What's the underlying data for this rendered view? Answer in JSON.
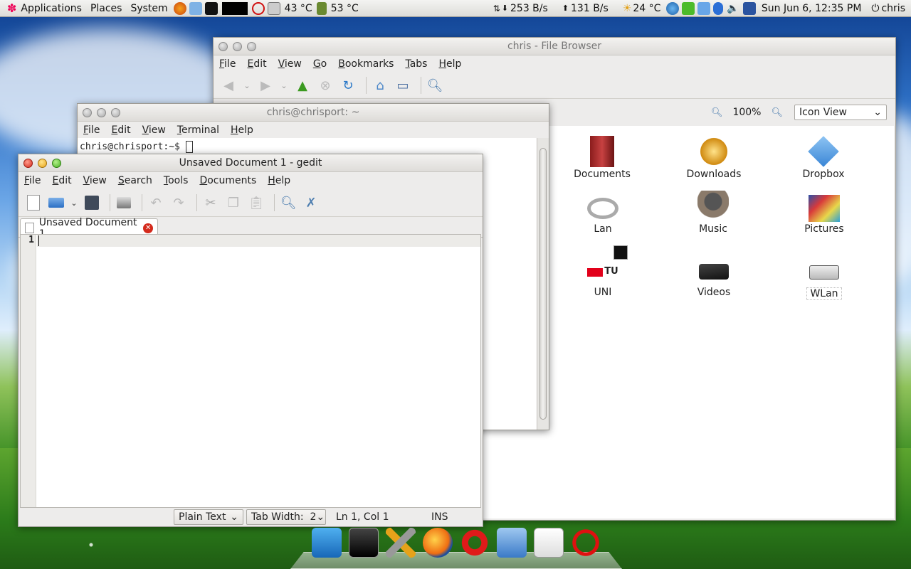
{
  "panel": {
    "menus": [
      "Applications",
      "Places",
      "System"
    ],
    "temp1": "43 °C",
    "temp2": "53 °C",
    "net_down": "253 B/s",
    "net_up": "131 B/s",
    "weather": "24 °C",
    "clock": "Sun Jun  6, 12:35 PM",
    "user": "chris"
  },
  "file_browser": {
    "title": "chris - File Browser",
    "menu": [
      "File",
      "Edit",
      "View",
      "Go",
      "Bookmarks",
      "Tabs",
      "Help"
    ],
    "zoom": "100%",
    "view_mode": "Icon View",
    "items": [
      "Documents",
      "Downloads",
      "Dropbox",
      "Lan",
      "Music",
      "Pictures",
      "UNI",
      "Videos",
      "WLan"
    ],
    "uni_badge": "TU"
  },
  "terminal": {
    "title": "chris@chrisport: ~",
    "menu": [
      "File",
      "Edit",
      "View",
      "Terminal",
      "Help"
    ],
    "prompt": "chris@chrisport:~$ "
  },
  "gedit": {
    "title": "Unsaved Document 1 - gedit",
    "menu": [
      "File",
      "Edit",
      "View",
      "Search",
      "Tools",
      "Documents",
      "Help"
    ],
    "tab_label": "Unsaved Document 1",
    "line_number": "1",
    "status": {
      "language": "Plain Text",
      "tab_width": "Tab Width:  2",
      "position": "Ln 1, Col 1",
      "mode": "INS"
    }
  },
  "dock": {
    "items": [
      "desktop",
      "terminal",
      "system-tools",
      "firefox",
      "opera",
      "home-folder",
      "text-editor",
      "shutdown"
    ]
  }
}
